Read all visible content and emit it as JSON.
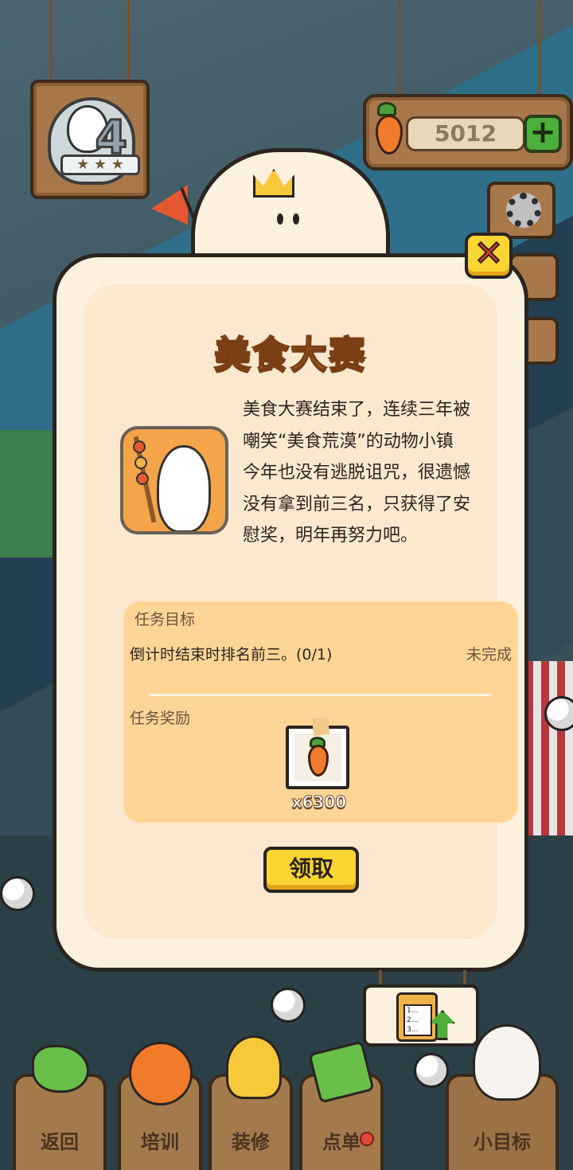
{
  "hud": {
    "level": "4",
    "currency": "5012",
    "plus": "+"
  },
  "dialog": {
    "title": "美食大赛",
    "story_lines": [
      "美食大赛结束了，连续三年被",
      "嘲笑“美食荒漠”的动物小镇",
      "今年也没有逃脱诅咒，很遗憾",
      "没有拿到前三名，只获得了安",
      "慰奖，明年再努力吧。"
    ],
    "close": "✕",
    "task": {
      "goal_label": "任务目标",
      "desc": "倒计时结束时排名前三。(0/1)",
      "status": "未完成",
      "reward_label": "任务奖励",
      "reward_qty": "x6300"
    },
    "claim": "领取"
  },
  "nav": {
    "back": "返回",
    "train": "培训",
    "decorate": "装修",
    "order": "点单",
    "goals": "小目标"
  },
  "hang_board": {
    "lines": [
      "1...",
      "2...",
      "3..."
    ]
  },
  "icons": {
    "level": "bunny-badge-icon",
    "currency": "carrot-icon",
    "settings": "gear-icon",
    "close": "close-icon",
    "reward": "carrot-icon",
    "board": "clipboard-upgrade-icon"
  },
  "colors": {
    "dialog_bg": "#fcf0df",
    "panel_bg": "#ffd596",
    "button_yellow": "#fbd531",
    "title_orange": "#f6a93a",
    "close_red": "#e03a2c"
  }
}
